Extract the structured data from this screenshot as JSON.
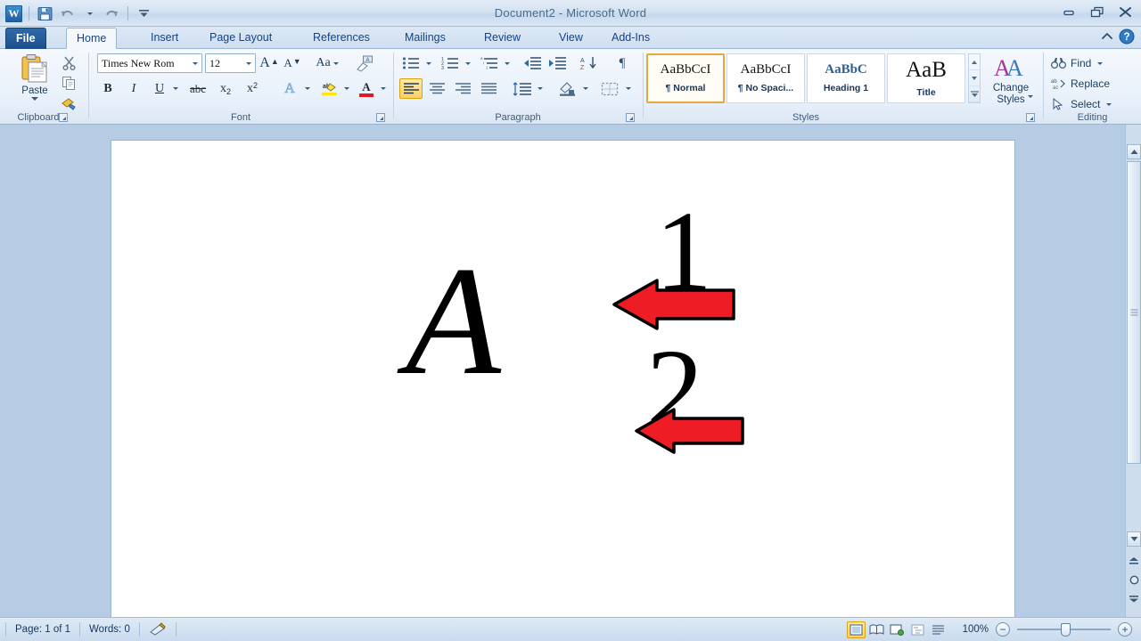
{
  "window": {
    "title": "Document2  -  Microsoft Word",
    "app_logo": "word-logo",
    "minimize": "minimize-icon",
    "restore": "restore-icon",
    "close": "close-icon",
    "help": "help-icon",
    "collapse_ribbon": "chevron-up-icon"
  },
  "quick_access": [
    {
      "name": "save",
      "icon": "save-icon"
    },
    {
      "name": "undo",
      "icon": "undo-icon"
    },
    {
      "name": "redo",
      "icon": "redo-icon"
    },
    {
      "name": "customize",
      "icon": "chevron-down-icon"
    }
  ],
  "tabs": [
    {
      "label": "File",
      "active": false,
      "file": true
    },
    {
      "label": "Home",
      "active": true
    },
    {
      "label": "Insert",
      "active": false
    },
    {
      "label": "Page Layout",
      "active": false
    },
    {
      "label": "References",
      "active": false
    },
    {
      "label": "Mailings",
      "active": false
    },
    {
      "label": "Review",
      "active": false
    },
    {
      "label": "View",
      "active": false
    },
    {
      "label": "Add-Ins",
      "active": false
    }
  ],
  "ribbon": {
    "clipboard": {
      "label": "Clipboard",
      "paste": "Paste",
      "cut": "cut-icon",
      "copy": "copy-icon",
      "format_painter": "format-painter-icon"
    },
    "font": {
      "label": "Font",
      "font_name": "Times New Rom",
      "font_size": "12",
      "grow_font": "A",
      "shrink_font": "A",
      "change_case": "Aa",
      "clear_formatting": "clear-formatting-icon",
      "bold": "B",
      "italic": "I",
      "underline": "U",
      "strikethrough": "abc",
      "subscript": "x",
      "subscript_index": "2",
      "superscript": "x",
      "superscript_index": "2",
      "text_effects": "A",
      "highlight": "ab",
      "font_color": "A"
    },
    "paragraph": {
      "label": "Paragraph",
      "bullets": "bullets-icon",
      "numbering": "numbering-icon",
      "multilevel": "multilevel-list-icon",
      "decrease_indent": "decrease-indent-icon",
      "increase_indent": "increase-indent-icon",
      "sort": "sort-icon",
      "show_marks": "¶",
      "align_left": "align-left-icon",
      "align_center": "align-center-icon",
      "align_right": "align-right-icon",
      "justify": "justify-icon",
      "line_spacing": "line-spacing-icon",
      "shading": "shading-icon",
      "borders": "borders-icon",
      "active_alignment": "align_left"
    },
    "styles": {
      "label": "Styles",
      "items": [
        {
          "sample": "AaBbCcI",
          "name": "¶ Normal",
          "selected": true,
          "color": "#111111"
        },
        {
          "sample": "AaBbCcI",
          "name": "¶ No Spaci...",
          "selected": false,
          "color": "#111111"
        },
        {
          "sample": "AaBbC",
          "name": "Heading 1",
          "selected": false,
          "color": "#2b5f96"
        },
        {
          "sample": "AaB",
          "name": "Title",
          "selected": false,
          "color": "#111111"
        }
      ],
      "change_styles": "Change",
      "change_styles_2": "Styles"
    },
    "editing": {
      "label": "Editing",
      "find": "Find",
      "replace": "Replace",
      "select": "Select",
      "find_icon": "binoculars-icon",
      "replace_icon": "replace-icon",
      "select_icon": "cursor-arrow-icon"
    }
  },
  "document": {
    "base_letter": "A",
    "superscript": "1",
    "subscript": "2",
    "annotations": [
      {
        "name": "arrow-superscript",
        "color": "#ee1c24",
        "direction": "left"
      },
      {
        "name": "arrow-subscript",
        "color": "#ee1c24",
        "direction": "left"
      }
    ]
  },
  "scrollbar": {
    "up": "scroll-up-icon",
    "down": "scroll-down-icon",
    "previous_page": "previous-page-icon",
    "browse_object": "select-browse-object-icon",
    "next_page": "next-page-icon",
    "ruler_toggle": "ruler-toggle-icon"
  },
  "status_bar": {
    "page": "Page: 1 of 1",
    "words": "Words: 0",
    "proofing": "proofing-icon",
    "views": [
      {
        "name": "print-layout",
        "icon": "print-layout-icon",
        "active": true
      },
      {
        "name": "full-screen",
        "icon": "full-screen-reading-icon",
        "active": false
      },
      {
        "name": "web-layout",
        "icon": "web-layout-icon",
        "active": false
      },
      {
        "name": "outline",
        "icon": "outline-icon",
        "active": false
      },
      {
        "name": "draft",
        "icon": "draft-icon",
        "active": false
      }
    ],
    "zoom_level": "100%",
    "zoom_out": "−",
    "zoom_in": "+"
  },
  "colors": {
    "accent_gold": "#ffd062",
    "ribbon_blue": "#dbe7f4",
    "title_text": "#4a6b8a",
    "doc_background": "#b6cce4",
    "arrow_red": "#ee1c24",
    "file_tab": "#1b4f8c"
  }
}
